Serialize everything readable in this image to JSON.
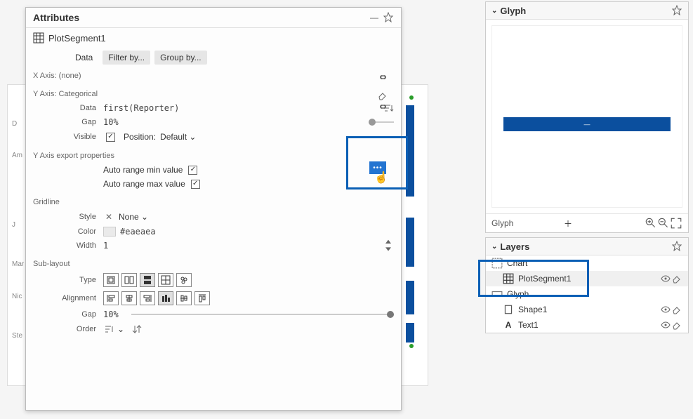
{
  "attributes": {
    "panel_title": "Attributes",
    "object_name": "PlotSegment1",
    "tabs": {
      "data": "Data",
      "filter": "Filter by...",
      "group": "Group by..."
    },
    "xaxis_label": "X Axis: (none)",
    "yaxis_label": "Y Axis: Categorical",
    "data_label": "Data",
    "data_value": "first(Reporter)",
    "gap_label": "Gap",
    "gap_value": "10%",
    "visible_label": "Visible",
    "position_label": "Position:",
    "position_value": "Default",
    "export_label": "Y Axis export properties",
    "auto_min": "Auto range min value",
    "auto_max": "Auto range max value",
    "gridline_label": "Gridline",
    "style_label": "Style",
    "style_value": "None",
    "color_label": "Color",
    "color_value": "#eaeaea",
    "width_label": "Width",
    "width_value": "1",
    "sublayout_label": "Sub-layout",
    "type_label": "Type",
    "alignment_label": "Alignment",
    "sub_gap_label": "Gap",
    "sub_gap_value": "10%",
    "order_label": "Order"
  },
  "canvas_labels": [
    "D",
    "Am",
    "J",
    "Mar",
    "Nic",
    "Ste"
  ],
  "glyph": {
    "panel_title": "Glyph",
    "footer_label": "Glyph"
  },
  "layers": {
    "panel_title": "Layers",
    "items": [
      {
        "name": "Chart",
        "kind": "chart",
        "indent": 0
      },
      {
        "name": "PlotSegment1",
        "kind": "plotsegment",
        "indent": 1,
        "selected": true
      },
      {
        "name": "Glyph",
        "kind": "glyph",
        "indent": 0
      },
      {
        "name": "Shape1",
        "kind": "shape",
        "indent": 1
      },
      {
        "name": "Text1",
        "kind": "text",
        "indent": 1
      }
    ]
  }
}
